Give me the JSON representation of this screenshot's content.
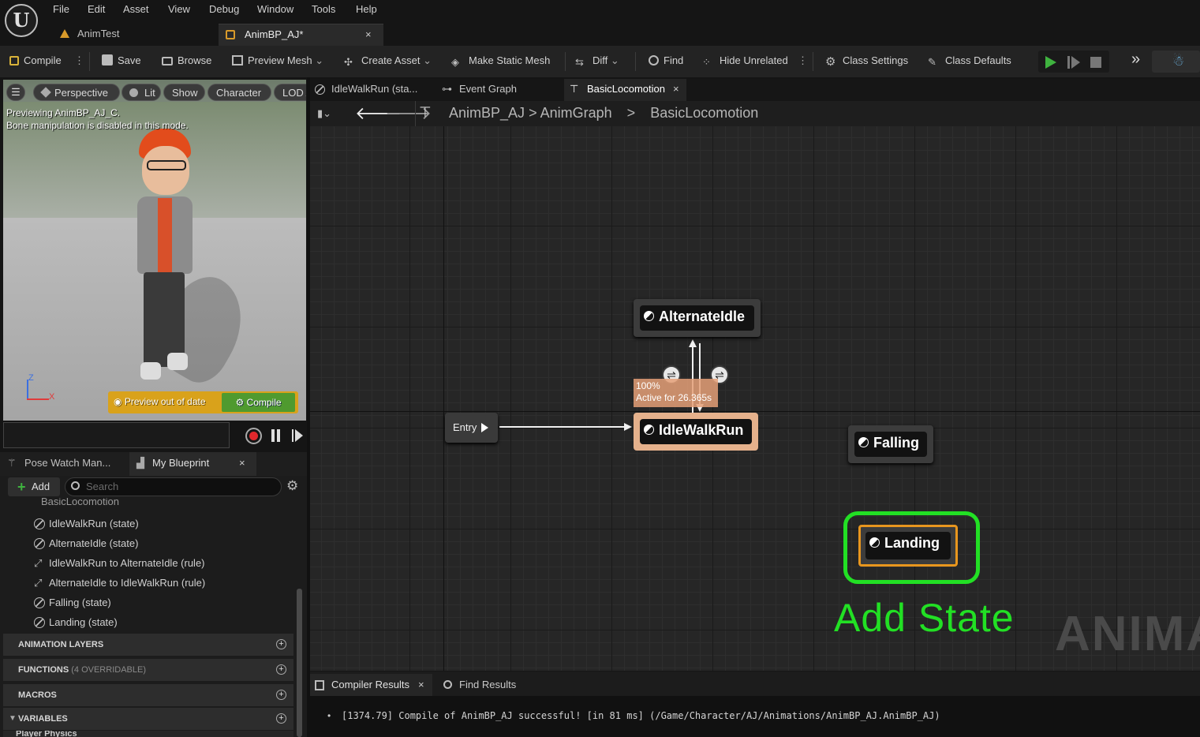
{
  "menu": [
    "File",
    "Edit",
    "Asset",
    "View",
    "Debug",
    "Window",
    "Tools",
    "Help"
  ],
  "doc_tabs": [
    {
      "label": "AnimTest"
    },
    {
      "label": "AnimBP_AJ*",
      "close": "×"
    }
  ],
  "toolbar": {
    "compile": "Compile",
    "save": "Save",
    "browse": "Browse",
    "preview_mesh": "Preview Mesh",
    "create_asset": "Create Asset",
    "make_static_mesh": "Make Static Mesh",
    "diff": "Diff",
    "find": "Find",
    "hide_unrelated": "Hide Unrelated",
    "class_settings": "Class Settings",
    "class_defaults": "Class Defaults"
  },
  "viewport": {
    "perspective": "Perspective",
    "lit": "Lit",
    "show": "Show",
    "character": "Character",
    "lod": "LOD A",
    "note1": "Previewing AnimBP_AJ_C.",
    "note2": "Bone manipulation is disabled in this mode.",
    "preview_out_of_date": "Preview out of date",
    "compile_btn": "Compile",
    "axis_z": "Z",
    "axis_x": "X"
  },
  "left_tabs": {
    "pose_watch": "Pose Watch Man...",
    "my_blueprint": "My Blueprint",
    "close": "×"
  },
  "my_blueprint": {
    "add": "Add",
    "search_placeholder": "Search",
    "parent_item": "BasicLocomotion",
    "items": [
      {
        "label": "IdleWalkRun (state)",
        "kind": "state"
      },
      {
        "label": "AlternateIdle (state)",
        "kind": "state"
      },
      {
        "label": "IdleWalkRun to AlternateIdle (rule)",
        "kind": "rule"
      },
      {
        "label": "AlternateIdle to IdleWalkRun (rule)",
        "kind": "rule"
      },
      {
        "label": "Falling (state)",
        "kind": "state"
      },
      {
        "label": "Landing (state)",
        "kind": "state"
      }
    ],
    "categories": [
      {
        "label": "ANIMATION LAYERS",
        "suffix": ""
      },
      {
        "label": "FUNCTIONS",
        "suffix": "(4 OVERRIDABLE)"
      },
      {
        "label": "MACROS",
        "suffix": ""
      },
      {
        "label": "VARIABLES",
        "suffix": ""
      }
    ],
    "sub_category": "Player Physics"
  },
  "graph_tabs": [
    {
      "label": "IdleWalkRun (sta..."
    },
    {
      "label": "Event Graph"
    },
    {
      "label": "BasicLocomotion",
      "close": "×"
    }
  ],
  "breadcrumb": {
    "root": "AnimBP_AJ",
    "level1": "AnimGraph",
    "level2": "BasicLocomotion",
    "sep": ">"
  },
  "graph": {
    "entry": "Entry",
    "nodes": {
      "alternate_idle": "AlternateIdle",
      "idle_walk_run": "IdleWalkRun",
      "falling": "Falling",
      "landing": "Landing"
    },
    "tooltip_line1": "100%",
    "tooltip_line2": "Active for 26.365s",
    "annotation": "Add State",
    "watermark": "ANIMAT"
  },
  "bottom": {
    "compiler_results": "Compiler Results",
    "find_results": "Find Results",
    "close": "×",
    "log": "[1374.79] Compile of AnimBP_AJ successful! [in 81 ms] (/Game/Character/AJ/Animations/AnimBP_AJ.AnimBP_AJ)"
  },
  "colors": {
    "accent_green": "#22e024",
    "active_node": "#e5b18c",
    "play_green": "#3fb33f",
    "preview_warning": "#d9a21b"
  }
}
